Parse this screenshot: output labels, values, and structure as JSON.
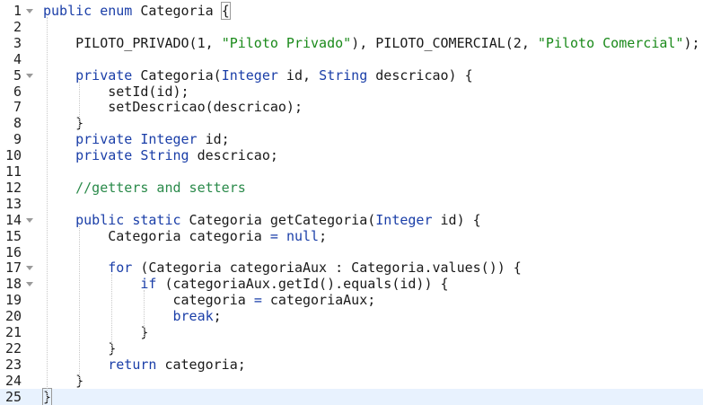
{
  "editor": {
    "language": "java",
    "active_line": 25,
    "lines": [
      {
        "n": "1",
        "fold": true,
        "tokens": [
          [
            "kw",
            "public"
          ],
          [
            "t",
            " "
          ],
          [
            "kw",
            "enum"
          ],
          [
            "t",
            " Categoria "
          ],
          [
            "box",
            "{"
          ]
        ]
      },
      {
        "n": "2",
        "fold": false,
        "tokens": []
      },
      {
        "n": "3",
        "fold": false,
        "tokens": [
          [
            "t",
            "    PILOTO_PRIVADO(1, "
          ],
          [
            "str",
            "\"Piloto Privado\""
          ],
          [
            "t",
            "), PILOTO_COMERCIAL(2, "
          ],
          [
            "str",
            "\"Piloto Comercial\""
          ],
          [
            "t",
            ");"
          ]
        ]
      },
      {
        "n": "4",
        "fold": false,
        "tokens": []
      },
      {
        "n": "5",
        "fold": true,
        "tokens": [
          [
            "t",
            "    "
          ],
          [
            "kw",
            "private"
          ],
          [
            "t",
            " Categoria("
          ],
          [
            "ty",
            "Integer"
          ],
          [
            "t",
            " id, "
          ],
          [
            "ty",
            "String"
          ],
          [
            "t",
            " descricao) {"
          ]
        ]
      },
      {
        "n": "6",
        "fold": false,
        "tokens": [
          [
            "t",
            "        setId(id);"
          ]
        ]
      },
      {
        "n": "7",
        "fold": false,
        "tokens": [
          [
            "t",
            "        setDescricao(descricao);"
          ]
        ]
      },
      {
        "n": "8",
        "fold": false,
        "tokens": [
          [
            "t",
            "    }"
          ]
        ]
      },
      {
        "n": "9",
        "fold": false,
        "tokens": [
          [
            "t",
            "    "
          ],
          [
            "kw",
            "private"
          ],
          [
            "t",
            " "
          ],
          [
            "ty",
            "Integer"
          ],
          [
            "t",
            " id;"
          ]
        ]
      },
      {
        "n": "10",
        "fold": false,
        "tokens": [
          [
            "t",
            "    "
          ],
          [
            "kw",
            "private"
          ],
          [
            "t",
            " "
          ],
          [
            "ty",
            "String"
          ],
          [
            "t",
            " descricao;"
          ]
        ]
      },
      {
        "n": "11",
        "fold": false,
        "tokens": []
      },
      {
        "n": "12",
        "fold": false,
        "tokens": [
          [
            "t",
            "    "
          ],
          [
            "cm",
            "//getters and setters"
          ]
        ]
      },
      {
        "n": "13",
        "fold": false,
        "tokens": []
      },
      {
        "n": "14",
        "fold": true,
        "tokens": [
          [
            "t",
            "    "
          ],
          [
            "kw",
            "public"
          ],
          [
            "t",
            " "
          ],
          [
            "kw",
            "static"
          ],
          [
            "t",
            " Categoria getCategoria("
          ],
          [
            "ty",
            "Integer"
          ],
          [
            "t",
            " id) {"
          ]
        ]
      },
      {
        "n": "15",
        "fold": false,
        "tokens": [
          [
            "t",
            "        Categoria categoria "
          ],
          [
            "op",
            "="
          ],
          [
            "t",
            " "
          ],
          [
            "nl",
            "null"
          ],
          [
            "t",
            ";"
          ]
        ]
      },
      {
        "n": "16",
        "fold": false,
        "tokens": []
      },
      {
        "n": "17",
        "fold": true,
        "tokens": [
          [
            "t",
            "        "
          ],
          [
            "kw",
            "for"
          ],
          [
            "t",
            " (Categoria categoriaAux : Categoria.values()) {"
          ]
        ]
      },
      {
        "n": "18",
        "fold": true,
        "tokens": [
          [
            "t",
            "            "
          ],
          [
            "kw",
            "if"
          ],
          [
            "t",
            " (categoriaAux.getId().equals(id)) {"
          ]
        ]
      },
      {
        "n": "19",
        "fold": false,
        "tokens": [
          [
            "t",
            "                categoria "
          ],
          [
            "op",
            "="
          ],
          [
            "t",
            " categoriaAux;"
          ]
        ]
      },
      {
        "n": "20",
        "fold": false,
        "tokens": [
          [
            "t",
            "                "
          ],
          [
            "kw",
            "break"
          ],
          [
            "t",
            ";"
          ]
        ]
      },
      {
        "n": "21",
        "fold": false,
        "tokens": [
          [
            "t",
            "            }"
          ]
        ]
      },
      {
        "n": "22",
        "fold": false,
        "tokens": [
          [
            "t",
            "        }"
          ]
        ]
      },
      {
        "n": "23",
        "fold": false,
        "tokens": [
          [
            "t",
            "        "
          ],
          [
            "kw",
            "return"
          ],
          [
            "t",
            " categoria;"
          ]
        ]
      },
      {
        "n": "24",
        "fold": false,
        "tokens": [
          [
            "t",
            "    }"
          ]
        ]
      },
      {
        "n": "25",
        "fold": false,
        "tokens": [
          [
            "box",
            "}"
          ]
        ]
      }
    ]
  },
  "colors": {
    "keyword": "#1a3ea8",
    "string": "#1a8a1a",
    "comment": "#2a8a4a",
    "active_line_bg": "#e8f2fe",
    "gutter_text": "#1f1f1f"
  }
}
